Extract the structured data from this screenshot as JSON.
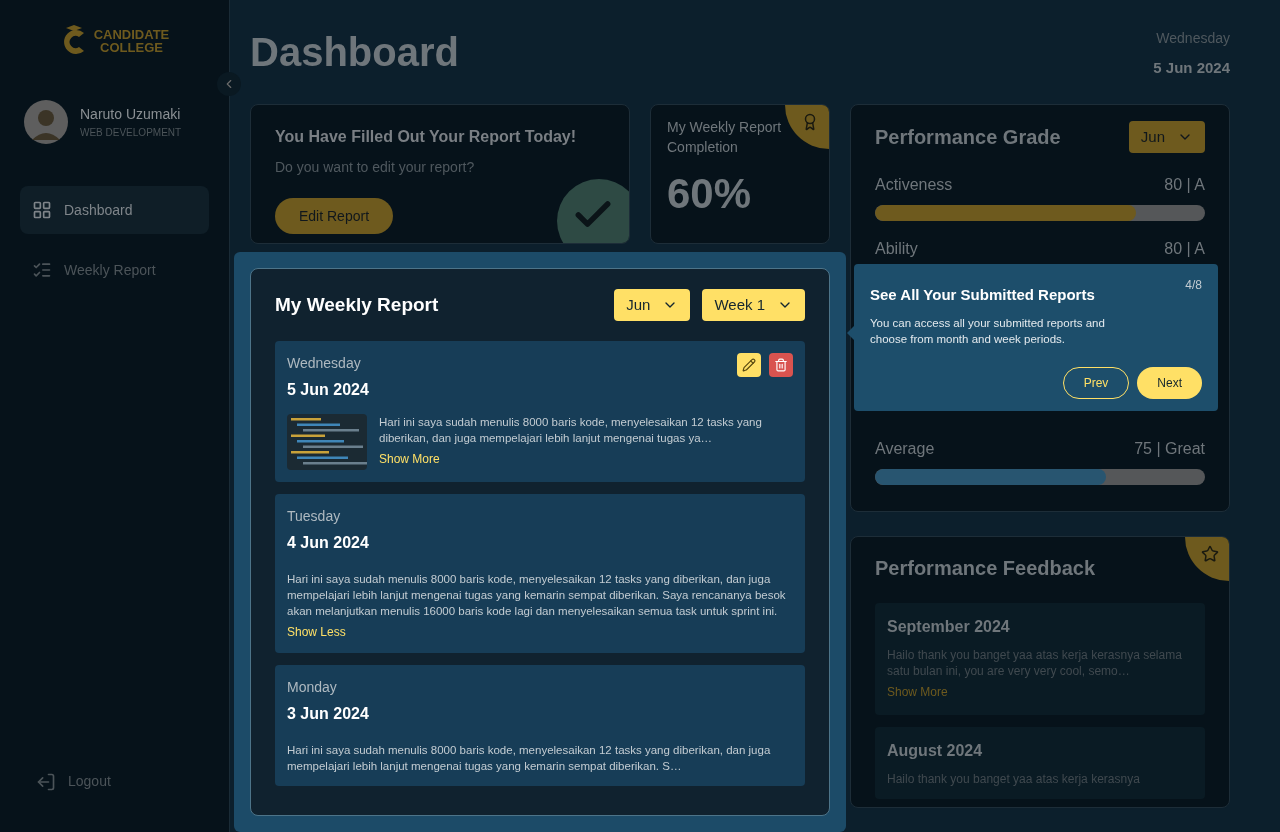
{
  "sidebar": {
    "logo": [
      "CANDIDATE",
      "COLLEGE"
    ],
    "user": {
      "name": "Naruto Uzumaki",
      "role": "WEB DEVELOPMENT"
    },
    "nav": [
      {
        "label": "Dashboard",
        "selected": true
      },
      {
        "label": "Weekly Report",
        "selected": false
      }
    ],
    "logout": "Logout"
  },
  "header": {
    "title": "Dashboard",
    "day": "Wednesday",
    "date": "5 Jun 2024"
  },
  "today_card": {
    "title": "You Have Filled Out Your Report Today!",
    "subtitle": "Do you want to edit your report?",
    "button": "Edit Report",
    "done": true
  },
  "completion_card": {
    "title": "My Weekly Report Completion",
    "value": "60%"
  },
  "weekly_report": {
    "title": "My Weekly Report",
    "month": "Jun",
    "week": "Week 1",
    "entries": [
      {
        "day": "Wednesday",
        "date": "5 Jun 2024",
        "editable": true,
        "text": "Hari ini saya sudah menulis 8000 baris kode, menyelesaikan 12 tasks yang diberikan, dan juga mempelajari lebih lanjut mengenai tugas ya…",
        "toggle": "Show More"
      },
      {
        "kind": "plain",
        "day": "Tuesday",
        "date": "4 Jun 2024",
        "editable": false,
        "text": "Hari ini saya sudah menulis 8000 baris kode, menyelesaikan 12 tasks yang diberikan, dan juga mempelajari lebih lanjut mengenai tugas yang kemarin sempat diberikan. Saya rencananya besok akan melanjutkan menulis 16000 baris kode lagi dan menyelesaikan semua task untuk sprint ini.",
        "toggle": "Show Less"
      },
      {
        "kind": "plain",
        "day": "Monday",
        "date": "3 Jun 2024",
        "editable": false,
        "text": "Hari ini saya sudah menulis 8000 baris kode, menyelesaikan 12 tasks yang diberikan, dan juga mempelajari lebih lanjut mengenai tugas yang kemarin sempat diberikan. S…"
      }
    ]
  },
  "performance_grade": {
    "title": "Performance Grade",
    "month": "Jun",
    "metrics": [
      {
        "name": "Activeness",
        "score": "80 | A",
        "kind": "gold",
        "level": 0.79
      },
      {
        "name": "Ability",
        "score": "80 | A",
        "kind": "hidden"
      },
      {
        "name": "Average",
        "score": "75 | Great",
        "kind": "blue",
        "level": 0.7
      }
    ]
  },
  "feedback": {
    "title": "Performance Feedback",
    "entries": [
      {
        "month": "September 2024",
        "text": "Hailo thank you banget yaa atas kerja kerasnya selama satu bulan ini, you are very very cool, semo…",
        "toggle": "Show More"
      },
      {
        "month": "August 2024",
        "text": "Hailo thank you banget yaa atas kerja kerasnya"
      }
    ]
  },
  "tour": {
    "title": "See All Your Submitted Reports",
    "step": "4/8",
    "text": "You can access all your submitted reports and choose from month and week periods.",
    "prev": "Prev",
    "next": "Next"
  }
}
